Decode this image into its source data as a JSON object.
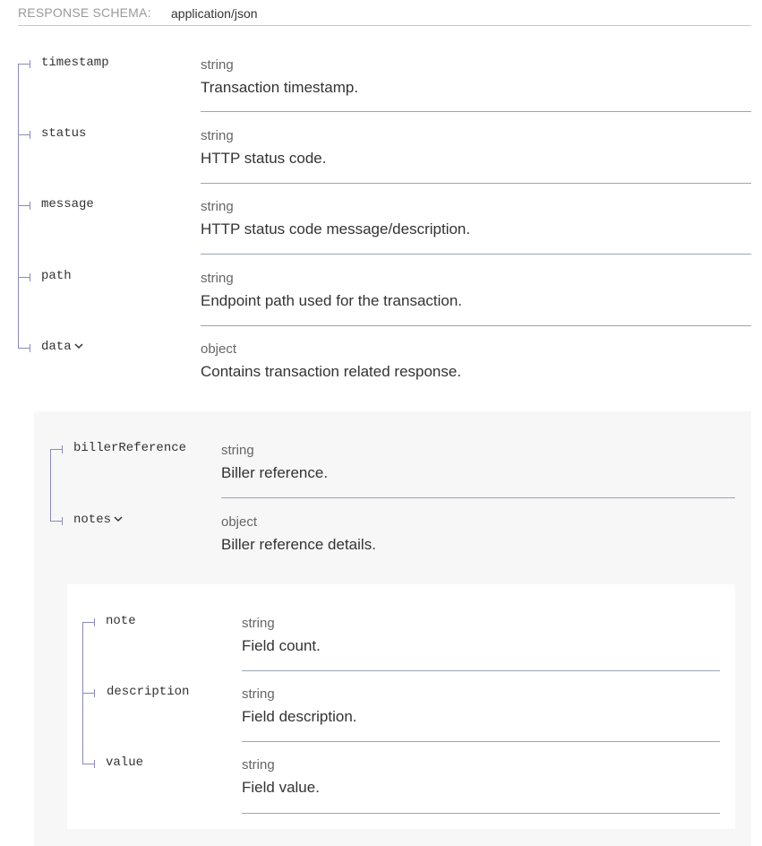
{
  "header": {
    "label": "RESPONSE SCHEMA:",
    "content_type": "application/json"
  },
  "colors": {
    "tree_line": "#8a8ab8",
    "separator": "#9aa6b3",
    "nested_bg": "#f7f7f7"
  },
  "properties": [
    {
      "name": "timestamp",
      "type": "string",
      "description": "Transaction timestamp."
    },
    {
      "name": "status",
      "type": "string",
      "description": "HTTP status code."
    },
    {
      "name": "message",
      "type": "string",
      "description": "HTTP status code message/description."
    },
    {
      "name": "path",
      "type": "string",
      "description": "Endpoint path used for the transaction."
    },
    {
      "name": "data",
      "type": "object",
      "description": "Contains transaction related response.",
      "expandable": true,
      "icon": "chevron-down-icon"
    }
  ],
  "data_properties": [
    {
      "name": "billerReference",
      "type": "string",
      "description": "Biller reference."
    },
    {
      "name": "notes",
      "type": "object",
      "description": "Biller reference details.",
      "expandable": true,
      "icon": "chevron-down-icon"
    }
  ],
  "notes_properties": [
    {
      "name": "note",
      "type": "string",
      "description": "Field count."
    },
    {
      "name": "description",
      "type": "string",
      "description": "Field description."
    },
    {
      "name": "value",
      "type": "string",
      "description": "Field value."
    }
  ]
}
